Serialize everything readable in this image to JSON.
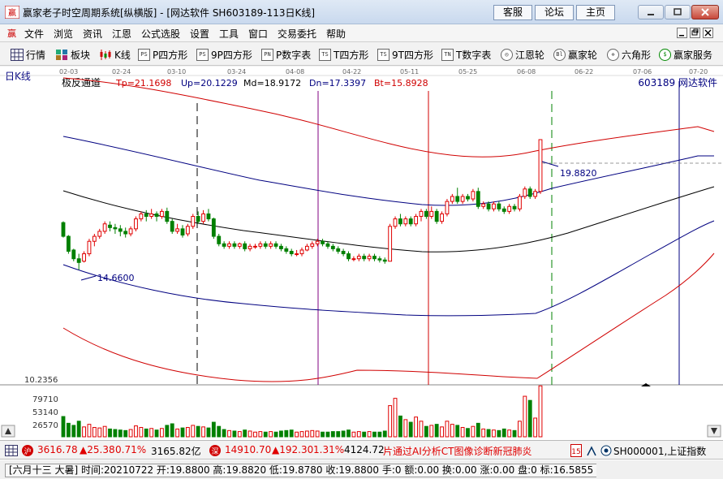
{
  "window": {
    "title": "赢家老子时空周期系统[纵横版] - [网达软件  SH603189-113日K线]",
    "links": [
      "客服",
      "论坛",
      "主页"
    ]
  },
  "menu": [
    "文件",
    "浏览",
    "资讯",
    "江恩",
    "公式选股",
    "设置",
    "工具",
    "窗口",
    "交易委托",
    "帮助"
  ],
  "toolbar": [
    {
      "label": "行情",
      "icon": "grid-icon"
    },
    {
      "label": "板块",
      "icon": "blocks-icon"
    },
    {
      "label": "K线",
      "icon": "candlestick-icon"
    },
    {
      "label": "P四方形",
      "icon": "ps-icon",
      "glyph": "PS"
    },
    {
      "label": "9P四方形",
      "icon": "9ps-icon",
      "glyph": "PS"
    },
    {
      "label": "P数字表",
      "icon": "pn-icon",
      "glyph": "PN"
    },
    {
      "label": "T四方形",
      "icon": "ts-icon",
      "glyph": "TS"
    },
    {
      "label": "9T四方形",
      "icon": "9ts-icon",
      "glyph": "TS"
    },
    {
      "label": "T数字表",
      "icon": "tn-icon",
      "glyph": "TN"
    },
    {
      "label": "江恩轮",
      "icon": "gann-wheel-icon",
      "glyph": "◎"
    },
    {
      "label": "赢家轮",
      "icon": "winner-wheel-icon",
      "glyph": "Bl"
    },
    {
      "label": "六角形",
      "icon": "hexagon-icon",
      "glyph": "✲"
    },
    {
      "label": "赢家服务",
      "icon": "dollar-icon",
      "glyph": "$"
    }
  ],
  "chart": {
    "period_label": "日K线",
    "indicator_name": "极反通道",
    "indicator_values": [
      {
        "label": "Tp=21.1698",
        "color": "#d00000"
      },
      {
        "label": "Up=20.1229",
        "color": "#000080"
      },
      {
        "label": "Md=18.9172",
        "color": "#000000"
      },
      {
        "label": "Dn=17.3397",
        "color": "#000080"
      },
      {
        "label": "Bt=15.8928",
        "color": "#d00000"
      }
    ],
    "stock_label": "603189  网达软件",
    "date_ticks": [
      "02-03",
      "02-24",
      "03-10",
      "03-24",
      "04-08",
      "04-22",
      "05-11",
      "05-25",
      "06-08",
      "06-22",
      "07-06",
      "07-20"
    ],
    "high_label": "19.8820",
    "low_label": "14.6600",
    "price_axis_label": "10.2356",
    "volume_ticks": [
      "79710",
      "53140",
      "26570"
    ]
  },
  "chart_data": {
    "type": "candlestick",
    "x_ticks": [
      "02-03",
      "02-24",
      "03-10",
      "03-24",
      "04-08",
      "04-22",
      "05-11",
      "05-25",
      "06-08",
      "06-22",
      "07-06",
      "07-20"
    ],
    "price_range": [
      10.2356,
      21.9
    ],
    "volume_ticks": [
      26570,
      53140,
      79710
    ],
    "annotated_high": 19.882,
    "annotated_low": 14.66,
    "bands": {
      "Tp": 21.1698,
      "Up": 20.1229,
      "Md": 18.9172,
      "Dn": 17.3397,
      "Bt": 15.8928
    },
    "candles": [
      [
        16.55,
        16.0,
        16.6,
        15.95,
        39000
      ],
      [
        16.0,
        15.4,
        16.05,
        15.3,
        26000
      ],
      [
        15.45,
        15.1,
        15.5,
        15.0,
        22000
      ],
      [
        15.1,
        14.95,
        15.3,
        14.66,
        30000
      ],
      [
        15.0,
        15.3,
        15.4,
        14.95,
        19000
      ],
      [
        15.3,
        15.8,
        15.9,
        15.2,
        24000
      ],
      [
        15.8,
        16.0,
        16.1,
        15.6,
        18000
      ],
      [
        16.0,
        16.2,
        16.3,
        15.9,
        17000
      ],
      [
        16.2,
        16.5,
        16.6,
        16.1,
        20000
      ],
      [
        16.45,
        16.35,
        16.6,
        16.2,
        15000
      ],
      [
        16.35,
        16.3,
        16.5,
        16.1,
        14000
      ],
      [
        16.3,
        16.2,
        16.45,
        16.0,
        13000
      ],
      [
        16.2,
        16.1,
        16.35,
        15.95,
        12000
      ],
      [
        16.1,
        16.3,
        16.4,
        16.0,
        14000
      ],
      [
        16.3,
        16.7,
        16.8,
        16.2,
        21000
      ],
      [
        16.7,
        16.9,
        17.0,
        16.6,
        18000
      ],
      [
        16.9,
        16.8,
        17.05,
        16.6,
        15000
      ],
      [
        16.8,
        16.9,
        17.1,
        16.7,
        16000
      ],
      [
        16.9,
        16.8,
        17.0,
        16.6,
        13000
      ],
      [
        16.8,
        17.0,
        17.1,
        16.7,
        16000
      ],
      [
        17.0,
        16.6,
        17.15,
        16.5,
        22000
      ],
      [
        16.6,
        16.2,
        16.7,
        16.1,
        25000
      ],
      [
        16.2,
        16.3,
        16.5,
        16.1,
        15000
      ],
      [
        16.3,
        16.05,
        16.45,
        15.95,
        17000
      ],
      [
        16.1,
        16.4,
        16.5,
        16.0,
        18000
      ],
      [
        16.4,
        16.8,
        16.9,
        16.3,
        22000
      ],
      [
        16.8,
        16.6,
        17.0,
        16.5,
        20000
      ],
      [
        16.6,
        16.9,
        17.05,
        16.5,
        19000
      ],
      [
        16.9,
        16.7,
        17.1,
        16.6,
        17000
      ],
      [
        16.7,
        16.0,
        16.75,
        15.9,
        28000
      ],
      [
        16.0,
        15.7,
        16.1,
        15.6,
        20000
      ],
      [
        15.7,
        15.6,
        15.8,
        15.5,
        14000
      ],
      [
        15.6,
        15.7,
        15.8,
        15.5,
        12000
      ],
      [
        15.7,
        15.6,
        15.8,
        15.5,
        11000
      ],
      [
        15.6,
        15.7,
        15.75,
        15.5,
        10000
      ],
      [
        15.7,
        15.5,
        15.8,
        15.4,
        13000
      ],
      [
        15.5,
        15.6,
        15.7,
        15.4,
        11000
      ],
      [
        15.6,
        15.6,
        15.7,
        15.5,
        9000
      ],
      [
        15.6,
        15.7,
        15.8,
        15.5,
        10000
      ],
      [
        15.7,
        15.6,
        15.8,
        15.5,
        9000
      ],
      [
        15.6,
        15.7,
        15.8,
        15.5,
        10000
      ],
      [
        15.7,
        15.6,
        15.8,
        15.5,
        9000
      ],
      [
        15.6,
        15.5,
        15.7,
        15.4,
        11000
      ],
      [
        15.5,
        15.4,
        15.6,
        15.3,
        12000
      ],
      [
        15.4,
        15.3,
        15.5,
        15.2,
        13000
      ],
      [
        15.3,
        15.3,
        15.45,
        15.2,
        9000
      ],
      [
        15.3,
        15.45,
        15.55,
        15.2,
        10000
      ],
      [
        15.45,
        15.6,
        15.7,
        15.4,
        11000
      ],
      [
        15.6,
        15.7,
        15.8,
        15.5,
        12000
      ],
      [
        15.7,
        15.8,
        15.9,
        15.6,
        11000
      ],
      [
        15.8,
        15.7,
        15.9,
        15.6,
        9000
      ],
      [
        15.7,
        15.6,
        15.8,
        15.5,
        9000
      ],
      [
        15.6,
        15.5,
        15.7,
        15.4,
        10000
      ],
      [
        15.5,
        15.4,
        15.6,
        15.3,
        10000
      ],
      [
        15.4,
        15.3,
        15.5,
        15.2,
        11000
      ],
      [
        15.3,
        15.1,
        15.4,
        15.0,
        13000
      ],
      [
        15.1,
        15.1,
        15.2,
        15.0,
        9000
      ],
      [
        15.1,
        15.2,
        15.3,
        15.0,
        10000
      ],
      [
        15.2,
        15.1,
        15.3,
        15.0,
        9000
      ],
      [
        15.1,
        15.2,
        15.3,
        15.0,
        10000
      ],
      [
        15.2,
        15.1,
        15.3,
        15.0,
        9000
      ],
      [
        15.1,
        15.05,
        15.2,
        14.95,
        9000
      ],
      [
        15.05,
        15.0,
        15.15,
        14.9,
        11000
      ],
      [
        15.0,
        16.4,
        16.5,
        15.0,
        60000
      ],
      [
        16.4,
        16.7,
        16.8,
        16.3,
        74000
      ],
      [
        16.7,
        16.5,
        16.9,
        16.4,
        40000
      ],
      [
        16.5,
        16.7,
        16.8,
        16.4,
        33000
      ],
      [
        16.7,
        16.5,
        16.8,
        16.4,
        28000
      ],
      [
        16.5,
        16.8,
        16.9,
        16.4,
        38000
      ],
      [
        16.8,
        17.0,
        17.1,
        16.6,
        30000
      ],
      [
        17.0,
        16.8,
        17.1,
        16.7,
        20000
      ],
      [
        16.8,
        17.0,
        17.2,
        16.7,
        22000
      ],
      [
        17.0,
        16.6,
        17.1,
        16.5,
        24000
      ],
      [
        16.6,
        16.9,
        17.0,
        16.5,
        19000
      ],
      [
        16.9,
        17.4,
        17.5,
        16.8,
        30000
      ],
      [
        17.4,
        17.6,
        17.7,
        17.3,
        24000
      ],
      [
        17.6,
        17.4,
        17.95,
        17.3,
        22000
      ],
      [
        17.4,
        17.6,
        17.7,
        17.3,
        18000
      ],
      [
        17.6,
        17.5,
        17.7,
        17.4,
        16000
      ],
      [
        17.5,
        17.8,
        17.9,
        17.4,
        20000
      ],
      [
        17.8,
        17.2,
        17.95,
        17.1,
        26000
      ],
      [
        17.2,
        17.3,
        17.4,
        17.1,
        15000
      ],
      [
        17.3,
        17.1,
        17.4,
        17.0,
        14000
      ],
      [
        17.1,
        17.3,
        17.4,
        17.0,
        13000
      ],
      [
        17.3,
        17.1,
        17.4,
        17.0,
        12000
      ],
      [
        17.1,
        17.0,
        17.2,
        16.9,
        15000
      ],
      [
        17.0,
        17.2,
        17.3,
        16.9,
        13000
      ],
      [
        17.2,
        17.1,
        17.3,
        17.0,
        12000
      ],
      [
        17.1,
        17.6,
        17.7,
        17.0,
        30000
      ],
      [
        17.6,
        17.9,
        18.0,
        17.5,
        78000
      ],
      [
        17.9,
        17.6,
        18.0,
        17.5,
        70000
      ],
      [
        17.6,
        17.8,
        17.9,
        17.5,
        36000
      ],
      [
        17.8,
        19.88,
        19.88,
        17.7,
        98000
      ]
    ]
  },
  "status1": {
    "index_value": "3616.78",
    "index_change": "▲25.38",
    "index_pct": "0.71%",
    "index_amount": "3165.82亿",
    "index2_value": "14910.70",
    "index2_change": "▲192.30",
    "index2_pct": "1.31%",
    "index2_amount": "4124.72",
    "ticker_news": "片通过AI分析CT图像诊断新冠肺炎",
    "index_code": "SH000001,上证指数"
  },
  "status2": {
    "info": "[六月十三 大暑] 时间:20210722 开:19.8800 高:19.8820 低:19.8780 收:19.8800 手:0 额:0.00 换:0.00 涨:0.00 盘:0 标:16.5855"
  },
  "colors": {
    "up": "#e00000",
    "down": "#008000",
    "upper_band": "#d00000",
    "mid_band": "#000080",
    "center_line": "#000000"
  }
}
